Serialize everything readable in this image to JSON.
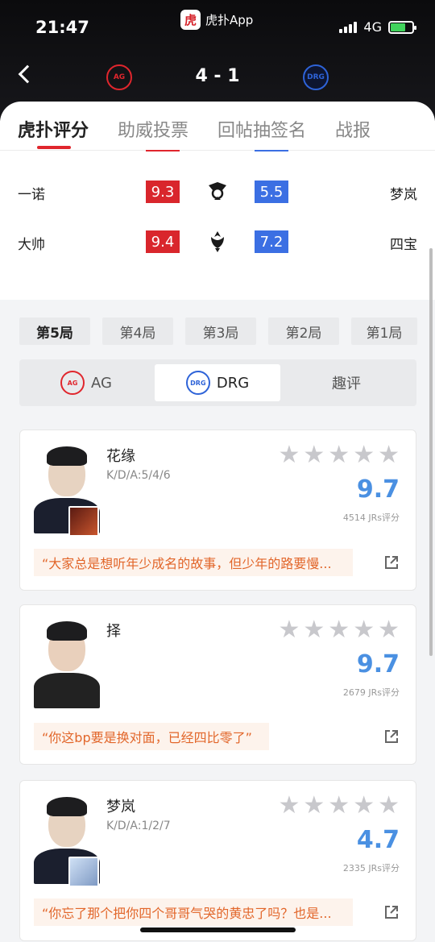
{
  "status": {
    "time": "21:47",
    "app_name": "虎扑App",
    "app_logo_char": "虎",
    "network": "4G"
  },
  "header": {
    "score": "4 - 1",
    "left_team": "AG",
    "right_team": "DRG"
  },
  "tabs": [
    {
      "label": "虎扑评分",
      "active": true
    },
    {
      "label": "助威投票",
      "active": false
    },
    {
      "label": "回帖抽签名",
      "active": false
    },
    {
      "label": "战报",
      "active": false
    }
  ],
  "matchups": [
    {
      "left": "一诺",
      "left_score": "9.3",
      "right_score": "5.5",
      "right": "梦岚",
      "role_icon": "marksman-icon"
    },
    {
      "left": "大帅",
      "left_score": "9.4",
      "right_score": "7.2",
      "right": "四宝",
      "role_icon": "support-icon"
    }
  ],
  "game_tabs": [
    "第5局",
    "第4局",
    "第3局",
    "第2局",
    "第1局"
  ],
  "team_segments": [
    {
      "label": "AG",
      "active": false
    },
    {
      "label": "DRG",
      "active": true
    },
    {
      "label": "趣评",
      "active": false
    }
  ],
  "players": [
    {
      "name": "花缘",
      "kda": "K/D/A:5/4/6",
      "rating": "9.7",
      "votes": "4514 JRs评分",
      "quote": "“大家总是想听年少成名的故事，但少年的路要慢...",
      "hero_color": "#7a2a1c"
    },
    {
      "name": "择",
      "kda": "",
      "rating": "9.7",
      "votes": "2679 JRs评分",
      "quote": "“你这bp要是换对面，已经四比零了”",
      "hero_color": ""
    },
    {
      "name": "梦岚",
      "kda": "K/D/A:1/2/7",
      "rating": "4.7",
      "votes": "2335 JRs评分",
      "quote": "“你忘了那个把你四个哥哥气哭的黄忠了吗？也是...",
      "hero_color": "#9fb7d8"
    }
  ],
  "colors": {
    "red": "#d9262c",
    "blue": "#3b6fe3",
    "rating_blue": "#4a90e2",
    "quote_orange": "#e2662a"
  }
}
